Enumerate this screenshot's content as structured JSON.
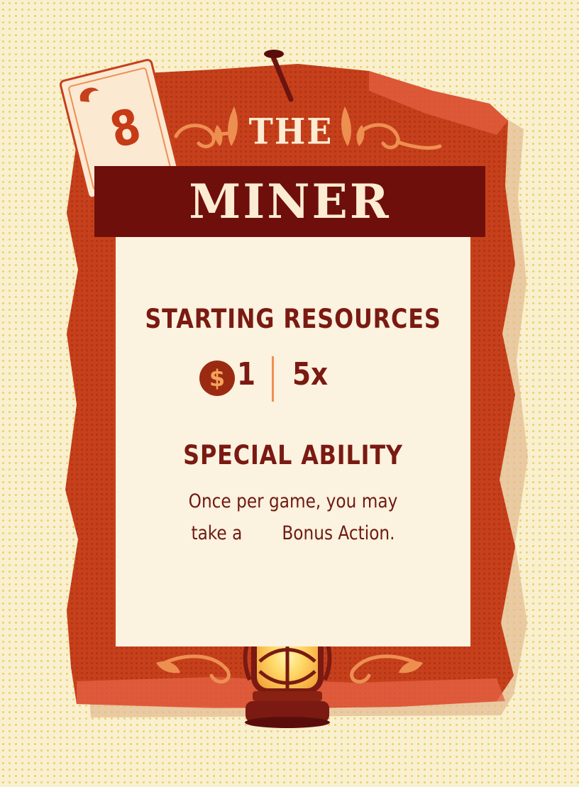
{
  "card": {
    "number": "8",
    "title_small": "THE",
    "title_large": "MINER",
    "starting_resources": {
      "heading": "STARTING RESOURCES",
      "money_symbol": "$",
      "money_amount": "1",
      "gold_count": "5x",
      "gold_icon": "gold-nugget-icon"
    },
    "special_ability": {
      "heading": "SPECIAL ABILITY",
      "line1": "Once per game, you may",
      "line2_before": "take a",
      "line2_icon": "red-diamond-icon",
      "line2_after": "Bonus Action."
    },
    "decoration_icon": "lantern-icon"
  },
  "colors": {
    "background": "#f8f0cf",
    "frame_red": "#c6401b",
    "banner_dark": "#6e0f0c",
    "text_cream": "#fbecd3",
    "text_maroon": "#7a1a12",
    "accent_orange": "#ee8f52",
    "diamond_red": "#c4161c",
    "gold": "#f2c230"
  }
}
